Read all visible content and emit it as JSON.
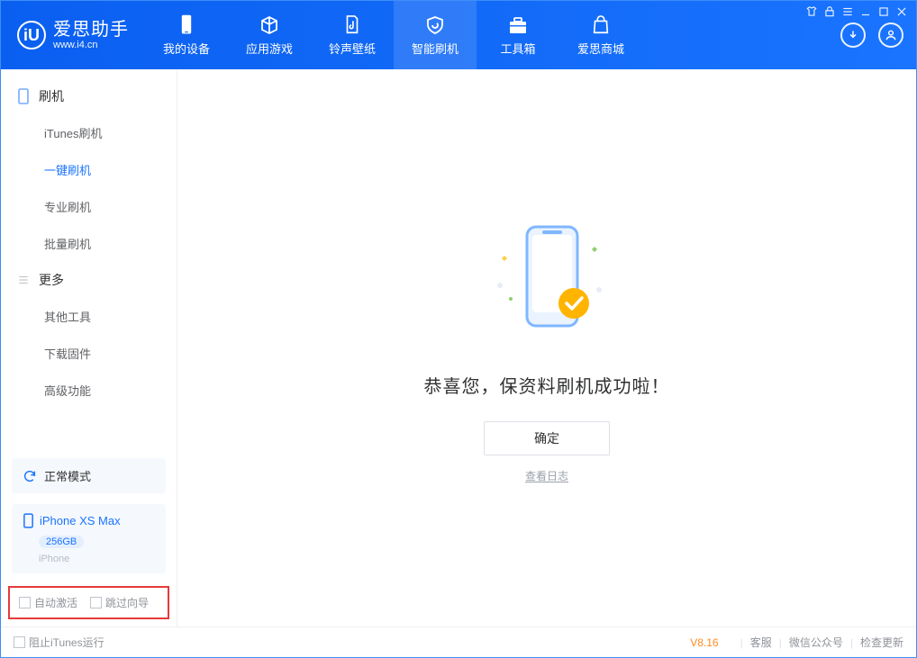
{
  "app": {
    "name": "爱思助手",
    "url": "www.i4.cn"
  },
  "nav": {
    "items": [
      {
        "label": "我的设备"
      },
      {
        "label": "应用游戏"
      },
      {
        "label": "铃声壁纸"
      },
      {
        "label": "智能刷机"
      },
      {
        "label": "工具箱"
      },
      {
        "label": "爱思商城"
      }
    ],
    "activeIndex": 3
  },
  "sidebar": {
    "group1": {
      "title": "刷机",
      "items": [
        "iTunes刷机",
        "一键刷机",
        "专业刷机",
        "批量刷机"
      ],
      "activeIndex": 1
    },
    "group2": {
      "title": "更多",
      "items": [
        "其他工具",
        "下载固件",
        "高级功能"
      ]
    },
    "mode_label": "正常模式",
    "device": {
      "name": "iPhone XS Max",
      "capacity": "256GB",
      "type": "iPhone"
    },
    "checkbox1": "自动激活",
    "checkbox2": "跳过向导"
  },
  "content": {
    "success_message": "恭喜您，保资料刷机成功啦！",
    "ok_button": "确定",
    "view_log": "查看日志"
  },
  "footer": {
    "block_itunes": "阻止iTunes运行",
    "version": "V8.16",
    "link1": "客服",
    "link2": "微信公众号",
    "link3": "检查更新"
  }
}
